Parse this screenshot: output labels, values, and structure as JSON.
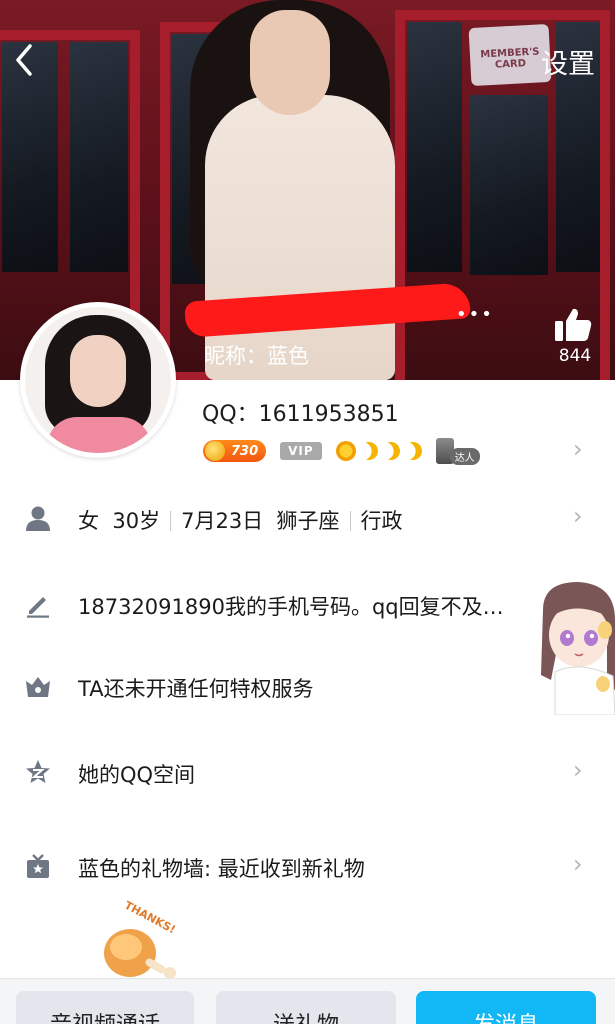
{
  "nav": {
    "back_icon": "chevron-left-icon",
    "settings_label": "设置"
  },
  "cover": {
    "member_card_text": "MEMBER'S CARD",
    "more_dots": "•••",
    "nickname": "昵称：蓝色",
    "like_icon": "thumbs-up-icon",
    "like_count": "844"
  },
  "profile": {
    "qq": "QQ：1611953851",
    "badges": {
      "coins": "730",
      "vip": "VIP",
      "level_icons": [
        "sun-icon",
        "moon-icon",
        "moon-icon",
        "moon-icon"
      ],
      "daren_label": "达人"
    }
  },
  "rows": [
    {
      "icon": "person-icon",
      "gender": "女",
      "age": "30岁",
      "birthday": "7月23日",
      "zodiac": "狮子座",
      "job": "行政"
    },
    {
      "icon": "pencil-icon",
      "text": "18732091890我的手机号码。qq回复不及…"
    },
    {
      "icon": "crown-icon",
      "text": "TA还未开通任何特权服务"
    },
    {
      "icon": "qzone-icon",
      "text": "她的QQ空间"
    },
    {
      "icon": "gift-icon",
      "text": "蓝色的礼物墙: 最近收到新礼物"
    }
  ],
  "decor": {
    "chicken_text": "THANKS!"
  },
  "bottom": {
    "call_label": "音视频通话",
    "gift_label": "送礼物",
    "message_label": "发消息"
  },
  "colors": {
    "accent": "#12b7f5",
    "window_frame": "#a61e2c",
    "redaction": "#ff1a1a",
    "coin_badge": "#f2560e"
  }
}
